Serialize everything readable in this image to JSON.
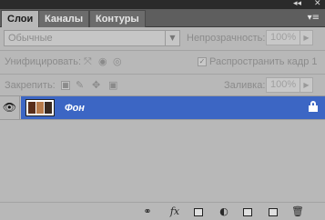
{
  "window": {
    "collapse_glyph": "◂◂",
    "close_glyph": "✕"
  },
  "tabs": [
    {
      "label": "Слои",
      "active": true
    },
    {
      "label": "Каналы",
      "active": false
    },
    {
      "label": "Контуры",
      "active": false
    }
  ],
  "panel_menu_glyph": "▾≡",
  "blend_mode": {
    "value": "Обычные"
  },
  "opacity": {
    "label": "Непрозрачность:",
    "value": "100%"
  },
  "unify": {
    "label": "Унифицировать:"
  },
  "propagate": {
    "label": "Распространить кадр 1",
    "checked": true
  },
  "lock": {
    "label": "Закрепить:"
  },
  "fill": {
    "label": "Заливка:",
    "value": "100%"
  },
  "layers": [
    {
      "name": "Фон",
      "visible": true,
      "locked": true,
      "selected": true
    }
  ],
  "colors": {
    "selection": "#3c66c4",
    "panel": "#b8b8b8",
    "tabbar": "#5e5e5e"
  }
}
